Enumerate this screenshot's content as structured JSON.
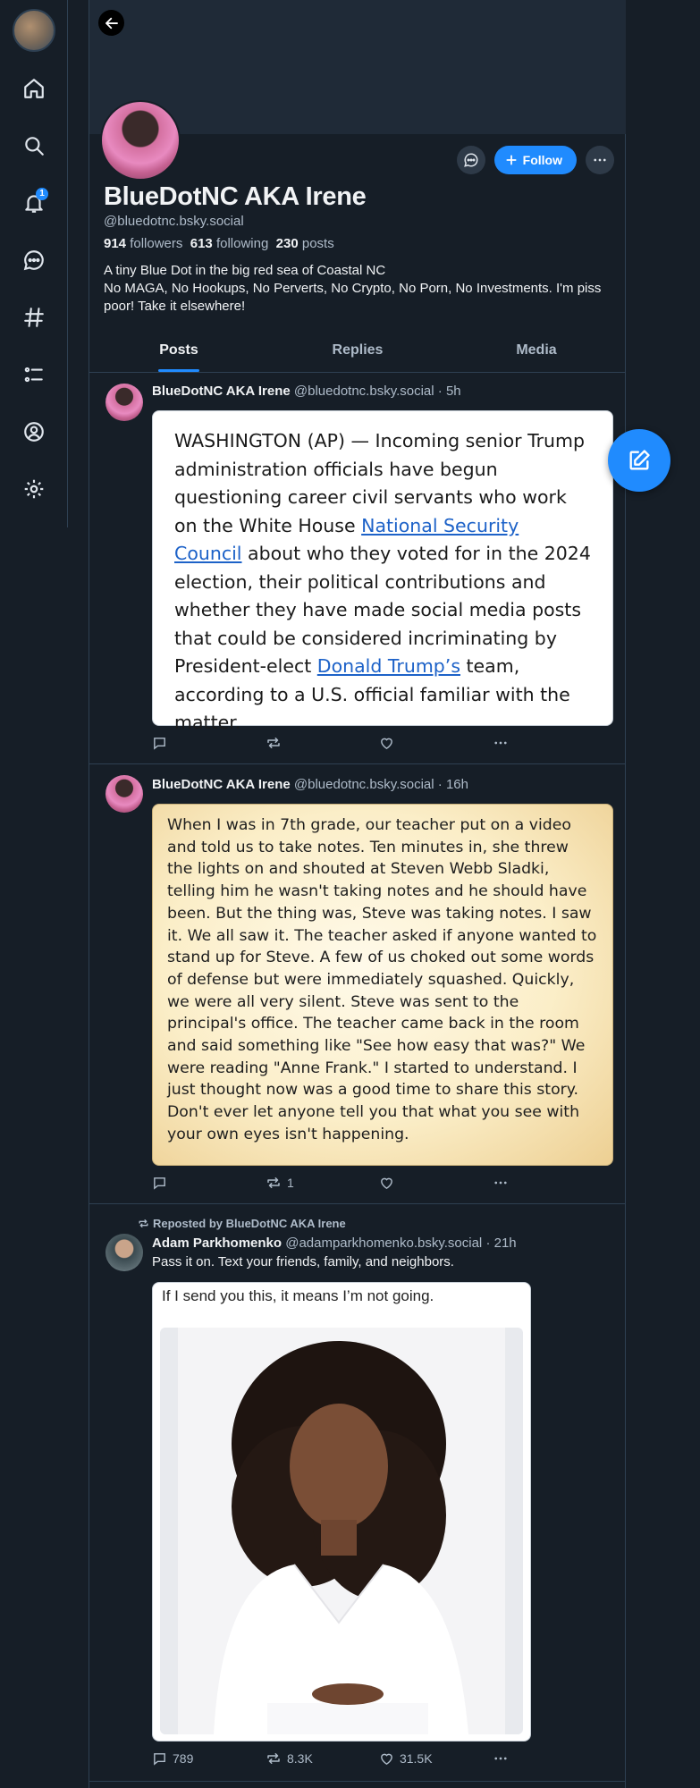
{
  "nav": {
    "notification_count": "1",
    "items": [
      {
        "name": "home-icon"
      },
      {
        "name": "search-icon"
      },
      {
        "name": "bell-icon"
      },
      {
        "name": "chat-icon"
      },
      {
        "name": "hashtag-icon"
      },
      {
        "name": "list-icon"
      },
      {
        "name": "profile-icon"
      },
      {
        "name": "gear-icon"
      }
    ]
  },
  "profile": {
    "display_name": "BlueDotNC AKA Irene",
    "handle": "@bluedotnc.bsky.social",
    "followers_count": "914",
    "followers_label": "followers",
    "following_count": "613",
    "following_label": "following",
    "posts_count": "230",
    "posts_label": "posts",
    "bio": "A tiny Blue Dot in the big red sea of Coastal NC\nNo MAGA, No Hookups, No Perverts, No Crypto, No Porn, No Investments. I'm piss poor!  Take it elsewhere!",
    "follow_label": "Follow"
  },
  "tabs": [
    {
      "label": "Posts",
      "active": true
    },
    {
      "label": "Replies",
      "active": false
    },
    {
      "label": "Media",
      "active": false
    }
  ],
  "posts": [
    {
      "author": "BlueDotNC AKA Irene",
      "handle": "@bluedotnc.bsky.social",
      "time": "· 5h",
      "image_text": {
        "part1": "WASHINGTON (AP) — Incoming senior Trump administration officials have begun questioning career civil servants who work on the White House ",
        "link1": "National Security Council",
        "part2": " about who they voted for in the 2024 election, their political contributions and whether they have made social media posts that could be considered incriminating by President-elect ",
        "link2": "Donald Trump’s",
        "part3": " team, according to a U.S. official familiar with the matter."
      },
      "replies": "",
      "reposts": "",
      "likes": ""
    },
    {
      "author": "BlueDotNC AKA Irene",
      "handle": "@bluedotnc.bsky.social",
      "time": "· 16h",
      "image_text": "When I was in 7th grade, our teacher put on a video and told us to take notes. Ten minutes in, she threw the lights on and shouted at Steven Webb Sladki, telling him he wasn't taking notes and he should have been. But the thing was, Steve was taking notes. I saw it. We all saw it. The teacher asked if anyone wanted to stand up for Steve. A few of us choked out some words of defense but were immediately squashed. Quickly, we were all very silent. Steve was sent to the principal's office. The teacher came back in the room and said something like \"See how easy that was?\" We were reading \"Anne Frank.\" I started to understand. I just thought now was a good time to share this story. Don't ever let anyone tell you that what you see with your own eyes isn't happening.",
      "replies": "",
      "reposts": "1",
      "likes": ""
    },
    {
      "repost_label": "Reposted by BlueDotNC AKA Irene",
      "author": "Adam Parkhomenko",
      "handle": "@adamparkhomenko.bsky.social",
      "time": "· 21h",
      "text": "Pass it on. Text your friends, family, and neighbors.",
      "image_text": "If I send you this, it means I’m not going.",
      "replies": "789",
      "reposts": "8.3K",
      "likes": "31.5K"
    }
  ],
  "colors": {
    "background": "#161e27",
    "accent": "#208bfe",
    "muted_text": "#aebbc9",
    "border": "#2e4052"
  }
}
